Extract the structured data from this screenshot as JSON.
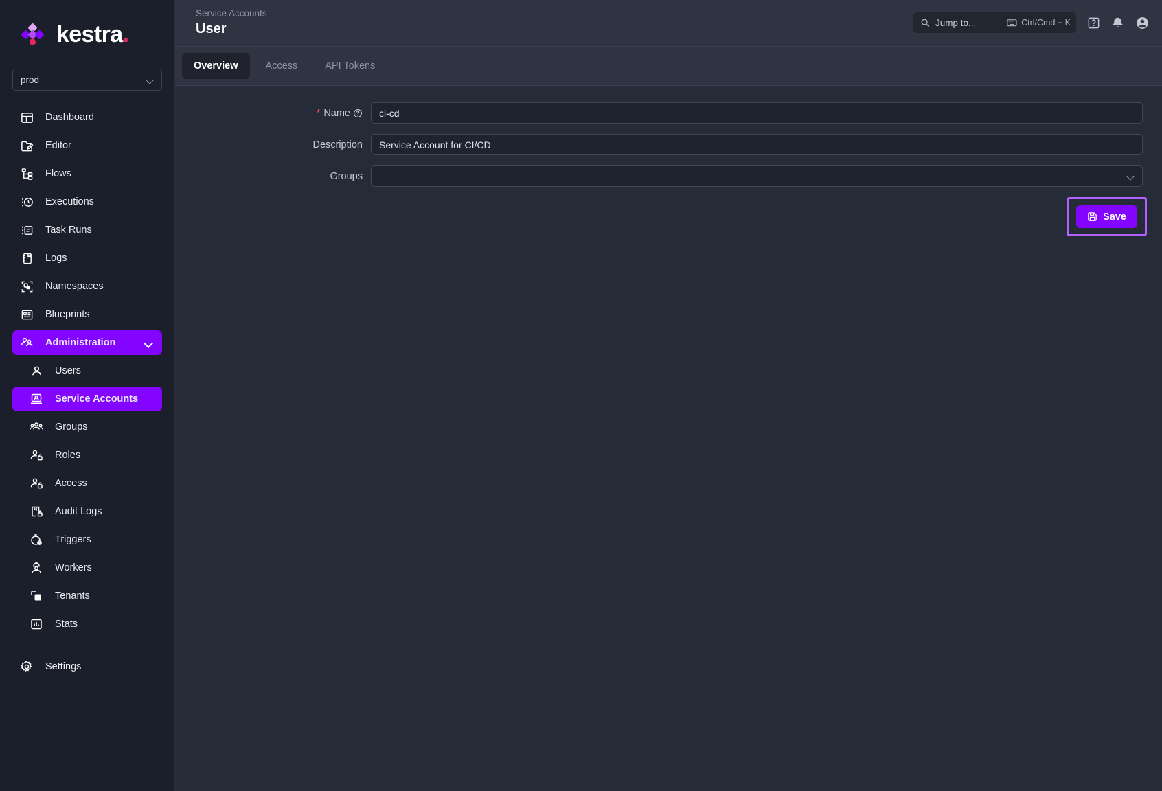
{
  "brand": {
    "name": "kestra",
    "dot": ".",
    "accent": "#8405FF",
    "dot_color": "#E5255E"
  },
  "sidebar": {
    "tenant": {
      "value": "prod",
      "icon": "chevron-down-icon"
    },
    "items": [
      {
        "label": "Dashboard",
        "icon": "dashboard-icon",
        "level": "top"
      },
      {
        "label": "Editor",
        "icon": "editor-icon",
        "level": "top"
      },
      {
        "label": "Flows",
        "icon": "flows-icon",
        "level": "top"
      },
      {
        "label": "Executions",
        "icon": "executions-icon",
        "level": "top"
      },
      {
        "label": "Task Runs",
        "icon": "task-runs-icon",
        "level": "top"
      },
      {
        "label": "Logs",
        "icon": "logs-icon",
        "level": "top"
      },
      {
        "label": "Namespaces",
        "icon": "namespaces-icon",
        "level": "top"
      },
      {
        "label": "Blueprints",
        "icon": "blueprints-icon",
        "level": "top"
      },
      {
        "label": "Administration",
        "icon": "administration-icon",
        "level": "top",
        "active": true,
        "expanded": true
      },
      {
        "label": "Users",
        "icon": "user-icon",
        "level": "sub"
      },
      {
        "label": "Service Accounts",
        "icon": "service-accounts-icon",
        "level": "sub",
        "active": true
      },
      {
        "label": "Groups",
        "icon": "groups-icon",
        "level": "sub"
      },
      {
        "label": "Roles",
        "icon": "roles-icon",
        "level": "sub"
      },
      {
        "label": "Access",
        "icon": "access-icon",
        "level": "sub"
      },
      {
        "label": "Audit Logs",
        "icon": "audit-logs-icon",
        "level": "sub"
      },
      {
        "label": "Triggers",
        "icon": "triggers-icon",
        "level": "sub"
      },
      {
        "label": "Workers",
        "icon": "workers-icon",
        "level": "sub"
      },
      {
        "label": "Tenants",
        "icon": "tenants-icon",
        "level": "sub"
      },
      {
        "label": "Stats",
        "icon": "stats-icon",
        "level": "sub"
      },
      {
        "label": "Settings",
        "icon": "gear-icon",
        "level": "sub"
      }
    ]
  },
  "header": {
    "breadcrumb": "Service Accounts",
    "title": "User",
    "search": {
      "placeholder": "Jump to...",
      "shortcut": "Ctrl/Cmd + K",
      "icon": "search-icon",
      "kbd_icon": "keyboard-icon"
    },
    "icons": [
      {
        "name": "help-icon",
        "glyph": "?"
      },
      {
        "name": "notifications-bell-icon",
        "glyph": "bell"
      },
      {
        "name": "account-avatar-icon",
        "glyph": "person"
      }
    ]
  },
  "tabs": [
    {
      "label": "Overview",
      "active": true
    },
    {
      "label": "Access",
      "active": false
    },
    {
      "label": "API Tokens",
      "active": false
    }
  ],
  "form": {
    "name": {
      "label": "Name",
      "required_marker": "*",
      "help_icon": "question-circle-icon",
      "value": "ci-cd",
      "placeholder": ""
    },
    "description": {
      "label": "Description",
      "value": "Service Account for CI/CD",
      "placeholder": ""
    },
    "groups": {
      "label": "Groups",
      "value": "",
      "placeholder": "",
      "icon": "chevron-down-icon"
    }
  },
  "actions": {
    "save_label": "Save",
    "save_icon": "save-disk-icon",
    "highlight_color": "#B260FF"
  }
}
